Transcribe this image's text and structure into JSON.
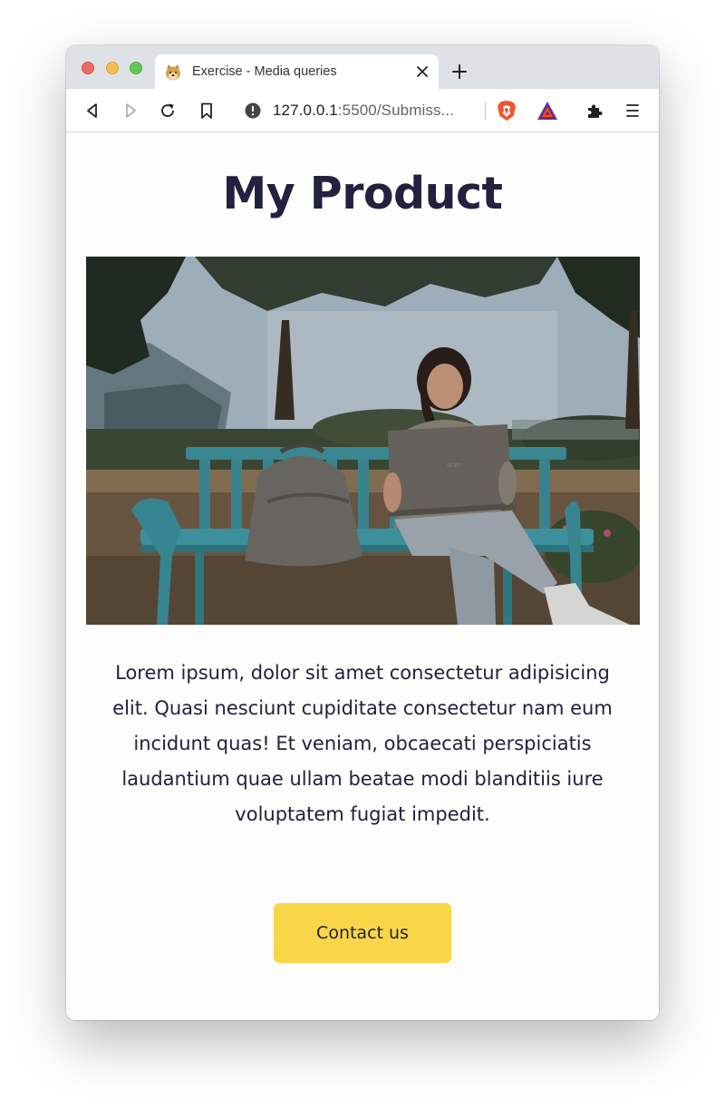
{
  "browser": {
    "tab": {
      "title": "Exercise - Media queries",
      "favicon": "doge-favicon"
    },
    "address_bar": {
      "host": "127.0.0.1",
      "path": ":5500/Submiss..."
    },
    "icons": [
      "back-icon",
      "forward-icon",
      "reload-icon",
      "bookmark-icon",
      "info-icon",
      "brave-shields-icon",
      "brave-rewards-icon",
      "extensions-icon",
      "menu-icon"
    ]
  },
  "page": {
    "heading": "My Product",
    "hero_image": "woman-with-laptop-on-park-bench",
    "body_text": "Lorem ipsum, dolor sit amet consectetur adipisicing elit. Quasi nesciunt cupiditate consectetur nam eum incidunt quas! Et veniam, obcaecati perspiciatis laudantium quae ullam beatae modi blanditiis iure voluptatem fugiat impedit.",
    "cta_label": "Contact us"
  },
  "colors": {
    "heading": "#22213f",
    "cta_background": "#f9d648",
    "page_background": "#fdfdfb"
  }
}
